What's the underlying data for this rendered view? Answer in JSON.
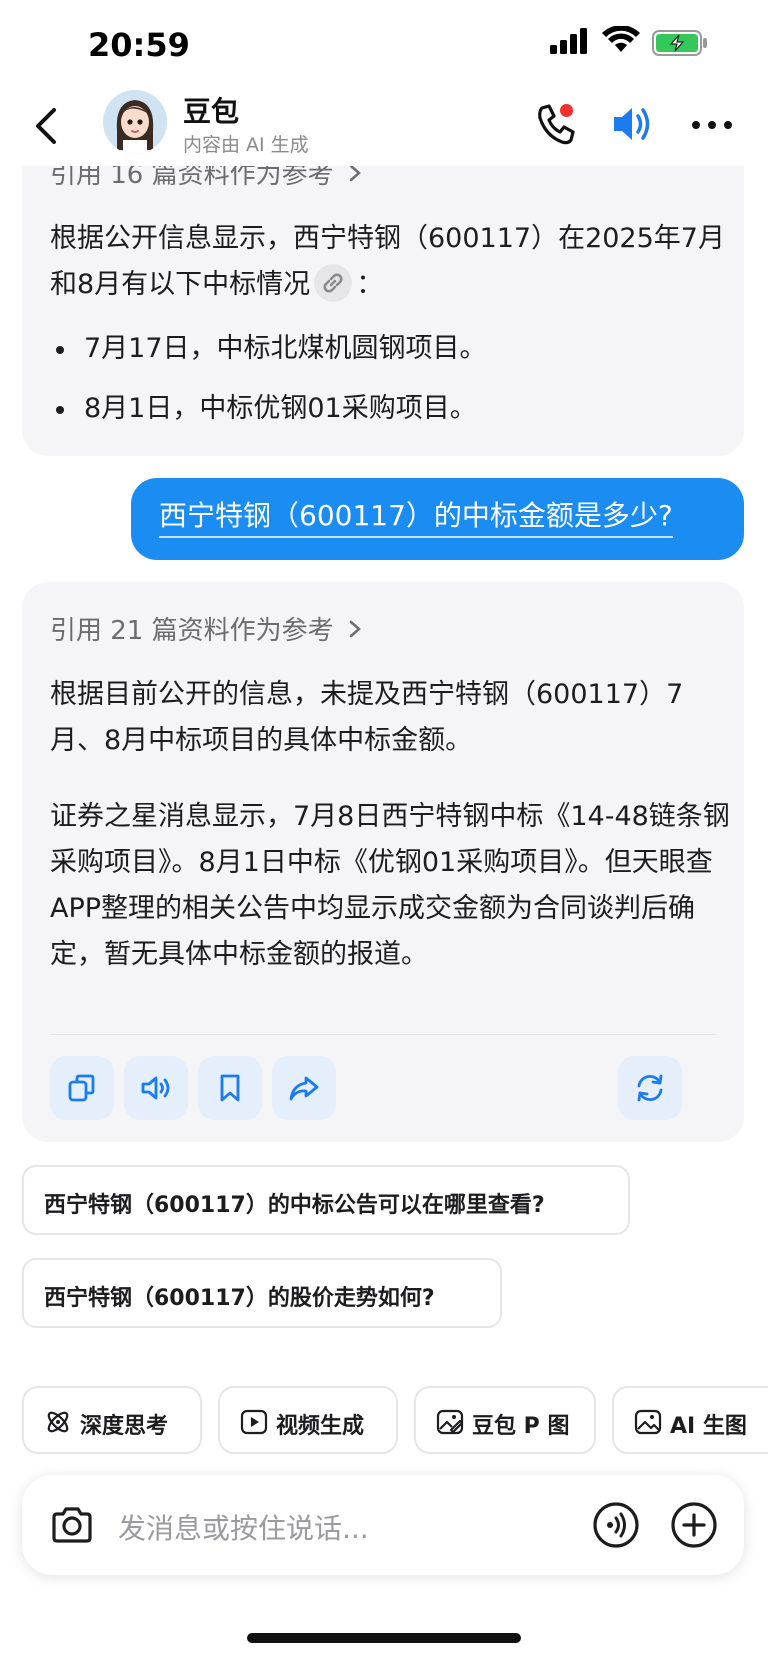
{
  "status": {
    "time": "20:59"
  },
  "header": {
    "title": "豆包",
    "subtitle": "内容由 AI 生成",
    "icons": [
      "back-chevron-icon",
      "phone-icon",
      "speaker-icon",
      "more-icon"
    ]
  },
  "messages": {
    "ai1": {
      "reference": "引用 16 篇资料作为参考",
      "intro_a": "根据公开信息显示，西宁特钢（600117）在2025年7月和8月有以下中标情况",
      "intro_b": "：",
      "bullets": [
        "7月17日，中标北煤机圆钢项目。",
        "8月1日，中标优钢01采购项目。"
      ]
    },
    "user": {
      "text": "西宁特钢（600117）的中标金额是多少?"
    },
    "ai2": {
      "reference": "引用 21 篇资料作为参考",
      "p1": "根据目前公开的信息，未提及西宁特钢（600117）7月、8月中标项目的具体中标金额。",
      "p2": "证券之星消息显示，7月8日西宁特钢中标《14-48链条钢采购项目》。8月1日中标《优钢01采购项目》。但天眼查APP整理的相关公告中均显示成交金额为合同谈判后确定，暂无具体中标金额的报道。",
      "actions": [
        "copy-icon",
        "read-aloud-icon",
        "bookmark-icon",
        "share-icon",
        "regenerate-icon"
      ]
    }
  },
  "suggestions": [
    "西宁特钢（600117）的中标公告可以在哪里查看?",
    "西宁特钢（600117）的股价走势如何?"
  ],
  "quick_actions": [
    {
      "label": "深度思考",
      "icon": "atom-icon"
    },
    {
      "label": "视频生成",
      "icon": "video-icon"
    },
    {
      "label": "豆包 P 图",
      "icon": "image-edit-icon"
    },
    {
      "label": "AI 生图",
      "icon": "image-icon"
    }
  ],
  "composer": {
    "placeholder": "发消息或按住说话..."
  },
  "colors": {
    "accent": "#1b8cf2",
    "bubble_bg": "#f5f5f7"
  }
}
